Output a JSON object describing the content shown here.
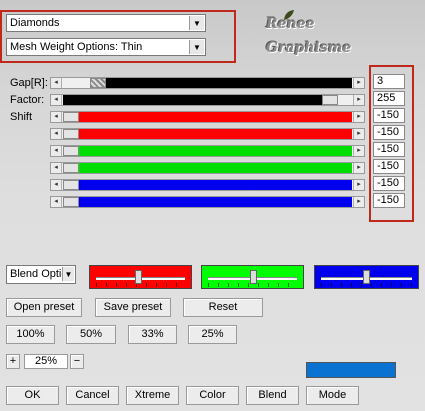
{
  "top": {
    "preset_select": "Diamonds",
    "mesh_select": "Mesh Weight Options: Thin"
  },
  "logo": {
    "line1": "Renee",
    "line2": "Graphisme"
  },
  "rows": [
    {
      "label": "Gap[R]:",
      "value": "3",
      "fill_fraction": 0.1,
      "color": "#000000",
      "fill_style": "checker"
    },
    {
      "label": "Factor:",
      "value": "255",
      "fill_fraction": 0.95,
      "color": "#000000",
      "fill_style": "solid"
    },
    {
      "label": "Shift",
      "value": "-150",
      "fill_fraction": 0.0,
      "color": "#ff0000",
      "fill_style": "solid"
    },
    {
      "label": "",
      "value": "-150",
      "fill_fraction": 0.0,
      "color": "#ff0000",
      "fill_style": "solid"
    },
    {
      "label": "",
      "value": "-150",
      "fill_fraction": 0.0,
      "color": "#00dd00",
      "fill_style": "solid"
    },
    {
      "label": "",
      "value": "-150",
      "fill_fraction": 0.0,
      "color": "#00dd00",
      "fill_style": "solid"
    },
    {
      "label": "",
      "value": "-150",
      "fill_fraction": 0.0,
      "color": "#0000ee",
      "fill_style": "solid"
    },
    {
      "label": "",
      "value": "-150",
      "fill_fraction": 0.0,
      "color": "#0000ee",
      "fill_style": "solid"
    }
  ],
  "blend": {
    "select": "Blend Optio",
    "panels": [
      {
        "color": "#ff0000",
        "level": 0.48
      },
      {
        "color": "#00ff00",
        "level": 0.52
      },
      {
        "color": "#0000ee",
        "level": 0.5
      }
    ]
  },
  "preset_buttons": {
    "open": "Open preset",
    "save": "Save preset",
    "reset": "Reset"
  },
  "zoom_buttons": [
    "100%",
    "50%",
    "33%",
    "25%"
  ],
  "zoom": {
    "plus": "+",
    "value": "25%",
    "minus": "−"
  },
  "color_swatch": "#0a72d0",
  "bottom_buttons": [
    "OK",
    "Cancel",
    "Xtreme",
    "Color",
    "Blend",
    "Mode"
  ],
  "accent": "#c0281c"
}
